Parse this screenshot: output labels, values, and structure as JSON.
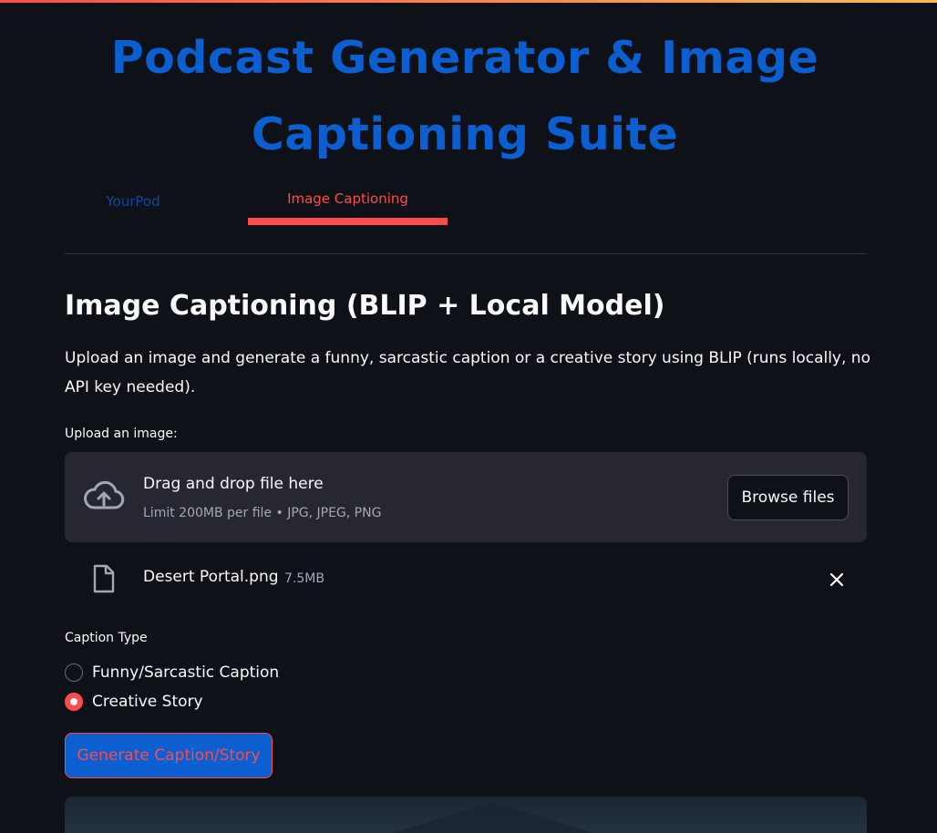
{
  "app": {
    "title": "Podcast Generator & Image Captioning Suite"
  },
  "tabs": [
    {
      "label": "YourPod",
      "active": false
    },
    {
      "label": "Image Captioning",
      "active": true
    }
  ],
  "section": {
    "title": "Image Captioning (BLIP + Local Model)",
    "description": "Upload an image and generate a funny, sarcastic caption or a creative story using BLIP (runs locally, no API key needed)."
  },
  "uploader": {
    "label": "Upload an image:",
    "dropzone_title": "Drag and drop file here",
    "dropzone_limit": "Limit 200MB per file • JPG, JPEG, PNG",
    "browse_label": "Browse files",
    "icon": "cloud-upload-icon"
  },
  "uploaded_file": {
    "name": "Desert Portal.png",
    "size": "7.5MB",
    "icon": "file-icon",
    "remove_icon": "close-icon"
  },
  "caption_type": {
    "label": "Caption Type",
    "options": [
      {
        "label": "Funny/Sarcastic Caption",
        "selected": false
      },
      {
        "label": "Creative Story",
        "selected": true
      }
    ]
  },
  "generate_button": {
    "label": "Generate Caption/Story"
  },
  "colors": {
    "background": "#0e1117",
    "title": "#0b5fd1",
    "accent": "#ff4b4b",
    "dropzone": "#262730",
    "muted_text": "#a3a8b8"
  }
}
